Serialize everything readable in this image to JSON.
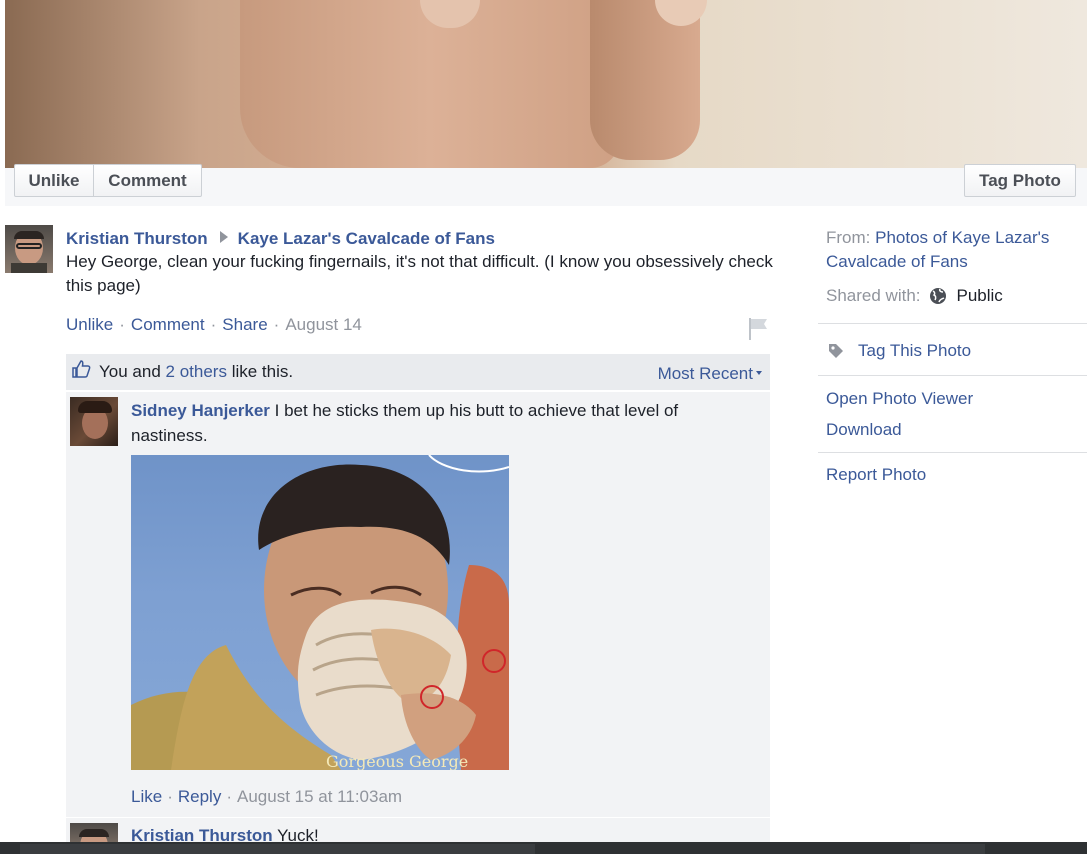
{
  "photo_bar": {
    "unlike_label": "Unlike",
    "comment_label": "Comment",
    "tag_photo_label": "Tag Photo"
  },
  "post": {
    "author": "Kristian Thurston",
    "target": "Kaye Lazar's Cavalcade of Fans",
    "text": "Hey George, clean your fucking fingernails, it's not that difficult. (I know you obsessively check this page)",
    "actions": {
      "unlike": "Unlike",
      "comment": "Comment",
      "share": "Share",
      "date": "August 14",
      "separator": "·"
    }
  },
  "likes": {
    "prefix": "You and",
    "others": "2 others",
    "suffix": "like this.",
    "sort_label": "Most Recent"
  },
  "comments": [
    {
      "author": "Sidney Hanjerker",
      "text": "I bet he sticks them up his butt to achieve that level of nastiness.",
      "image_caption": "Gorgeous George",
      "like": "Like",
      "reply": "Reply",
      "date": "August 15 at 11:03am"
    },
    {
      "author": "Kristian Thurston",
      "text": "Yuck!"
    }
  ],
  "sidebar": {
    "from_label": "From:",
    "from_value": "Photos of Kaye Lazar's Cavalcade of Fans",
    "shared_label": "Shared with:",
    "shared_value": "Public",
    "tag_this_photo": "Tag This Photo",
    "open_viewer": "Open Photo Viewer",
    "download": "Download",
    "report": "Report Photo"
  },
  "icons": {
    "globe": "globe-icon",
    "tag": "tag-icon",
    "thumb": "thumbs-up-icon",
    "flag": "flag-icon"
  },
  "colors": {
    "link": "#3b5998",
    "muted": "#90949c",
    "likes_bg": "#e9ebee",
    "comments_bg": "#f2f3f5"
  }
}
